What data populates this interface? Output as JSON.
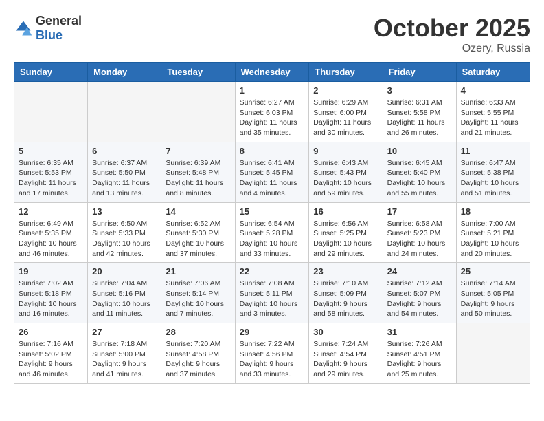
{
  "header": {
    "logo_general": "General",
    "logo_blue": "Blue",
    "month_year": "October 2025",
    "location": "Ozery, Russia"
  },
  "weekdays": [
    "Sunday",
    "Monday",
    "Tuesday",
    "Wednesday",
    "Thursday",
    "Friday",
    "Saturday"
  ],
  "rows": [
    [
      {
        "day": "",
        "info": ""
      },
      {
        "day": "",
        "info": ""
      },
      {
        "day": "",
        "info": ""
      },
      {
        "day": "1",
        "info": "Sunrise: 6:27 AM\nSunset: 6:03 PM\nDaylight: 11 hours\nand 35 minutes."
      },
      {
        "day": "2",
        "info": "Sunrise: 6:29 AM\nSunset: 6:00 PM\nDaylight: 11 hours\nand 30 minutes."
      },
      {
        "day": "3",
        "info": "Sunrise: 6:31 AM\nSunset: 5:58 PM\nDaylight: 11 hours\nand 26 minutes."
      },
      {
        "day": "4",
        "info": "Sunrise: 6:33 AM\nSunset: 5:55 PM\nDaylight: 11 hours\nand 21 minutes."
      }
    ],
    [
      {
        "day": "5",
        "info": "Sunrise: 6:35 AM\nSunset: 5:53 PM\nDaylight: 11 hours\nand 17 minutes."
      },
      {
        "day": "6",
        "info": "Sunrise: 6:37 AM\nSunset: 5:50 PM\nDaylight: 11 hours\nand 13 minutes."
      },
      {
        "day": "7",
        "info": "Sunrise: 6:39 AM\nSunset: 5:48 PM\nDaylight: 11 hours\nand 8 minutes."
      },
      {
        "day": "8",
        "info": "Sunrise: 6:41 AM\nSunset: 5:45 PM\nDaylight: 11 hours\nand 4 minutes."
      },
      {
        "day": "9",
        "info": "Sunrise: 6:43 AM\nSunset: 5:43 PM\nDaylight: 10 hours\nand 59 minutes."
      },
      {
        "day": "10",
        "info": "Sunrise: 6:45 AM\nSunset: 5:40 PM\nDaylight: 10 hours\nand 55 minutes."
      },
      {
        "day": "11",
        "info": "Sunrise: 6:47 AM\nSunset: 5:38 PM\nDaylight: 10 hours\nand 51 minutes."
      }
    ],
    [
      {
        "day": "12",
        "info": "Sunrise: 6:49 AM\nSunset: 5:35 PM\nDaylight: 10 hours\nand 46 minutes."
      },
      {
        "day": "13",
        "info": "Sunrise: 6:50 AM\nSunset: 5:33 PM\nDaylight: 10 hours\nand 42 minutes."
      },
      {
        "day": "14",
        "info": "Sunrise: 6:52 AM\nSunset: 5:30 PM\nDaylight: 10 hours\nand 37 minutes."
      },
      {
        "day": "15",
        "info": "Sunrise: 6:54 AM\nSunset: 5:28 PM\nDaylight: 10 hours\nand 33 minutes."
      },
      {
        "day": "16",
        "info": "Sunrise: 6:56 AM\nSunset: 5:25 PM\nDaylight: 10 hours\nand 29 minutes."
      },
      {
        "day": "17",
        "info": "Sunrise: 6:58 AM\nSunset: 5:23 PM\nDaylight: 10 hours\nand 24 minutes."
      },
      {
        "day": "18",
        "info": "Sunrise: 7:00 AM\nSunset: 5:21 PM\nDaylight: 10 hours\nand 20 minutes."
      }
    ],
    [
      {
        "day": "19",
        "info": "Sunrise: 7:02 AM\nSunset: 5:18 PM\nDaylight: 10 hours\nand 16 minutes."
      },
      {
        "day": "20",
        "info": "Sunrise: 7:04 AM\nSunset: 5:16 PM\nDaylight: 10 hours\nand 11 minutes."
      },
      {
        "day": "21",
        "info": "Sunrise: 7:06 AM\nSunset: 5:14 PM\nDaylight: 10 hours\nand 7 minutes."
      },
      {
        "day": "22",
        "info": "Sunrise: 7:08 AM\nSunset: 5:11 PM\nDaylight: 10 hours\nand 3 minutes."
      },
      {
        "day": "23",
        "info": "Sunrise: 7:10 AM\nSunset: 5:09 PM\nDaylight: 9 hours\nand 58 minutes."
      },
      {
        "day": "24",
        "info": "Sunrise: 7:12 AM\nSunset: 5:07 PM\nDaylight: 9 hours\nand 54 minutes."
      },
      {
        "day": "25",
        "info": "Sunrise: 7:14 AM\nSunset: 5:05 PM\nDaylight: 9 hours\nand 50 minutes."
      }
    ],
    [
      {
        "day": "26",
        "info": "Sunrise: 7:16 AM\nSunset: 5:02 PM\nDaylight: 9 hours\nand 46 minutes."
      },
      {
        "day": "27",
        "info": "Sunrise: 7:18 AM\nSunset: 5:00 PM\nDaylight: 9 hours\nand 41 minutes."
      },
      {
        "day": "28",
        "info": "Sunrise: 7:20 AM\nSunset: 4:58 PM\nDaylight: 9 hours\nand 37 minutes."
      },
      {
        "day": "29",
        "info": "Sunrise: 7:22 AM\nSunset: 4:56 PM\nDaylight: 9 hours\nand 33 minutes."
      },
      {
        "day": "30",
        "info": "Sunrise: 7:24 AM\nSunset: 4:54 PM\nDaylight: 9 hours\nand 29 minutes."
      },
      {
        "day": "31",
        "info": "Sunrise: 7:26 AM\nSunset: 4:51 PM\nDaylight: 9 hours\nand 25 minutes."
      },
      {
        "day": "",
        "info": ""
      }
    ]
  ]
}
